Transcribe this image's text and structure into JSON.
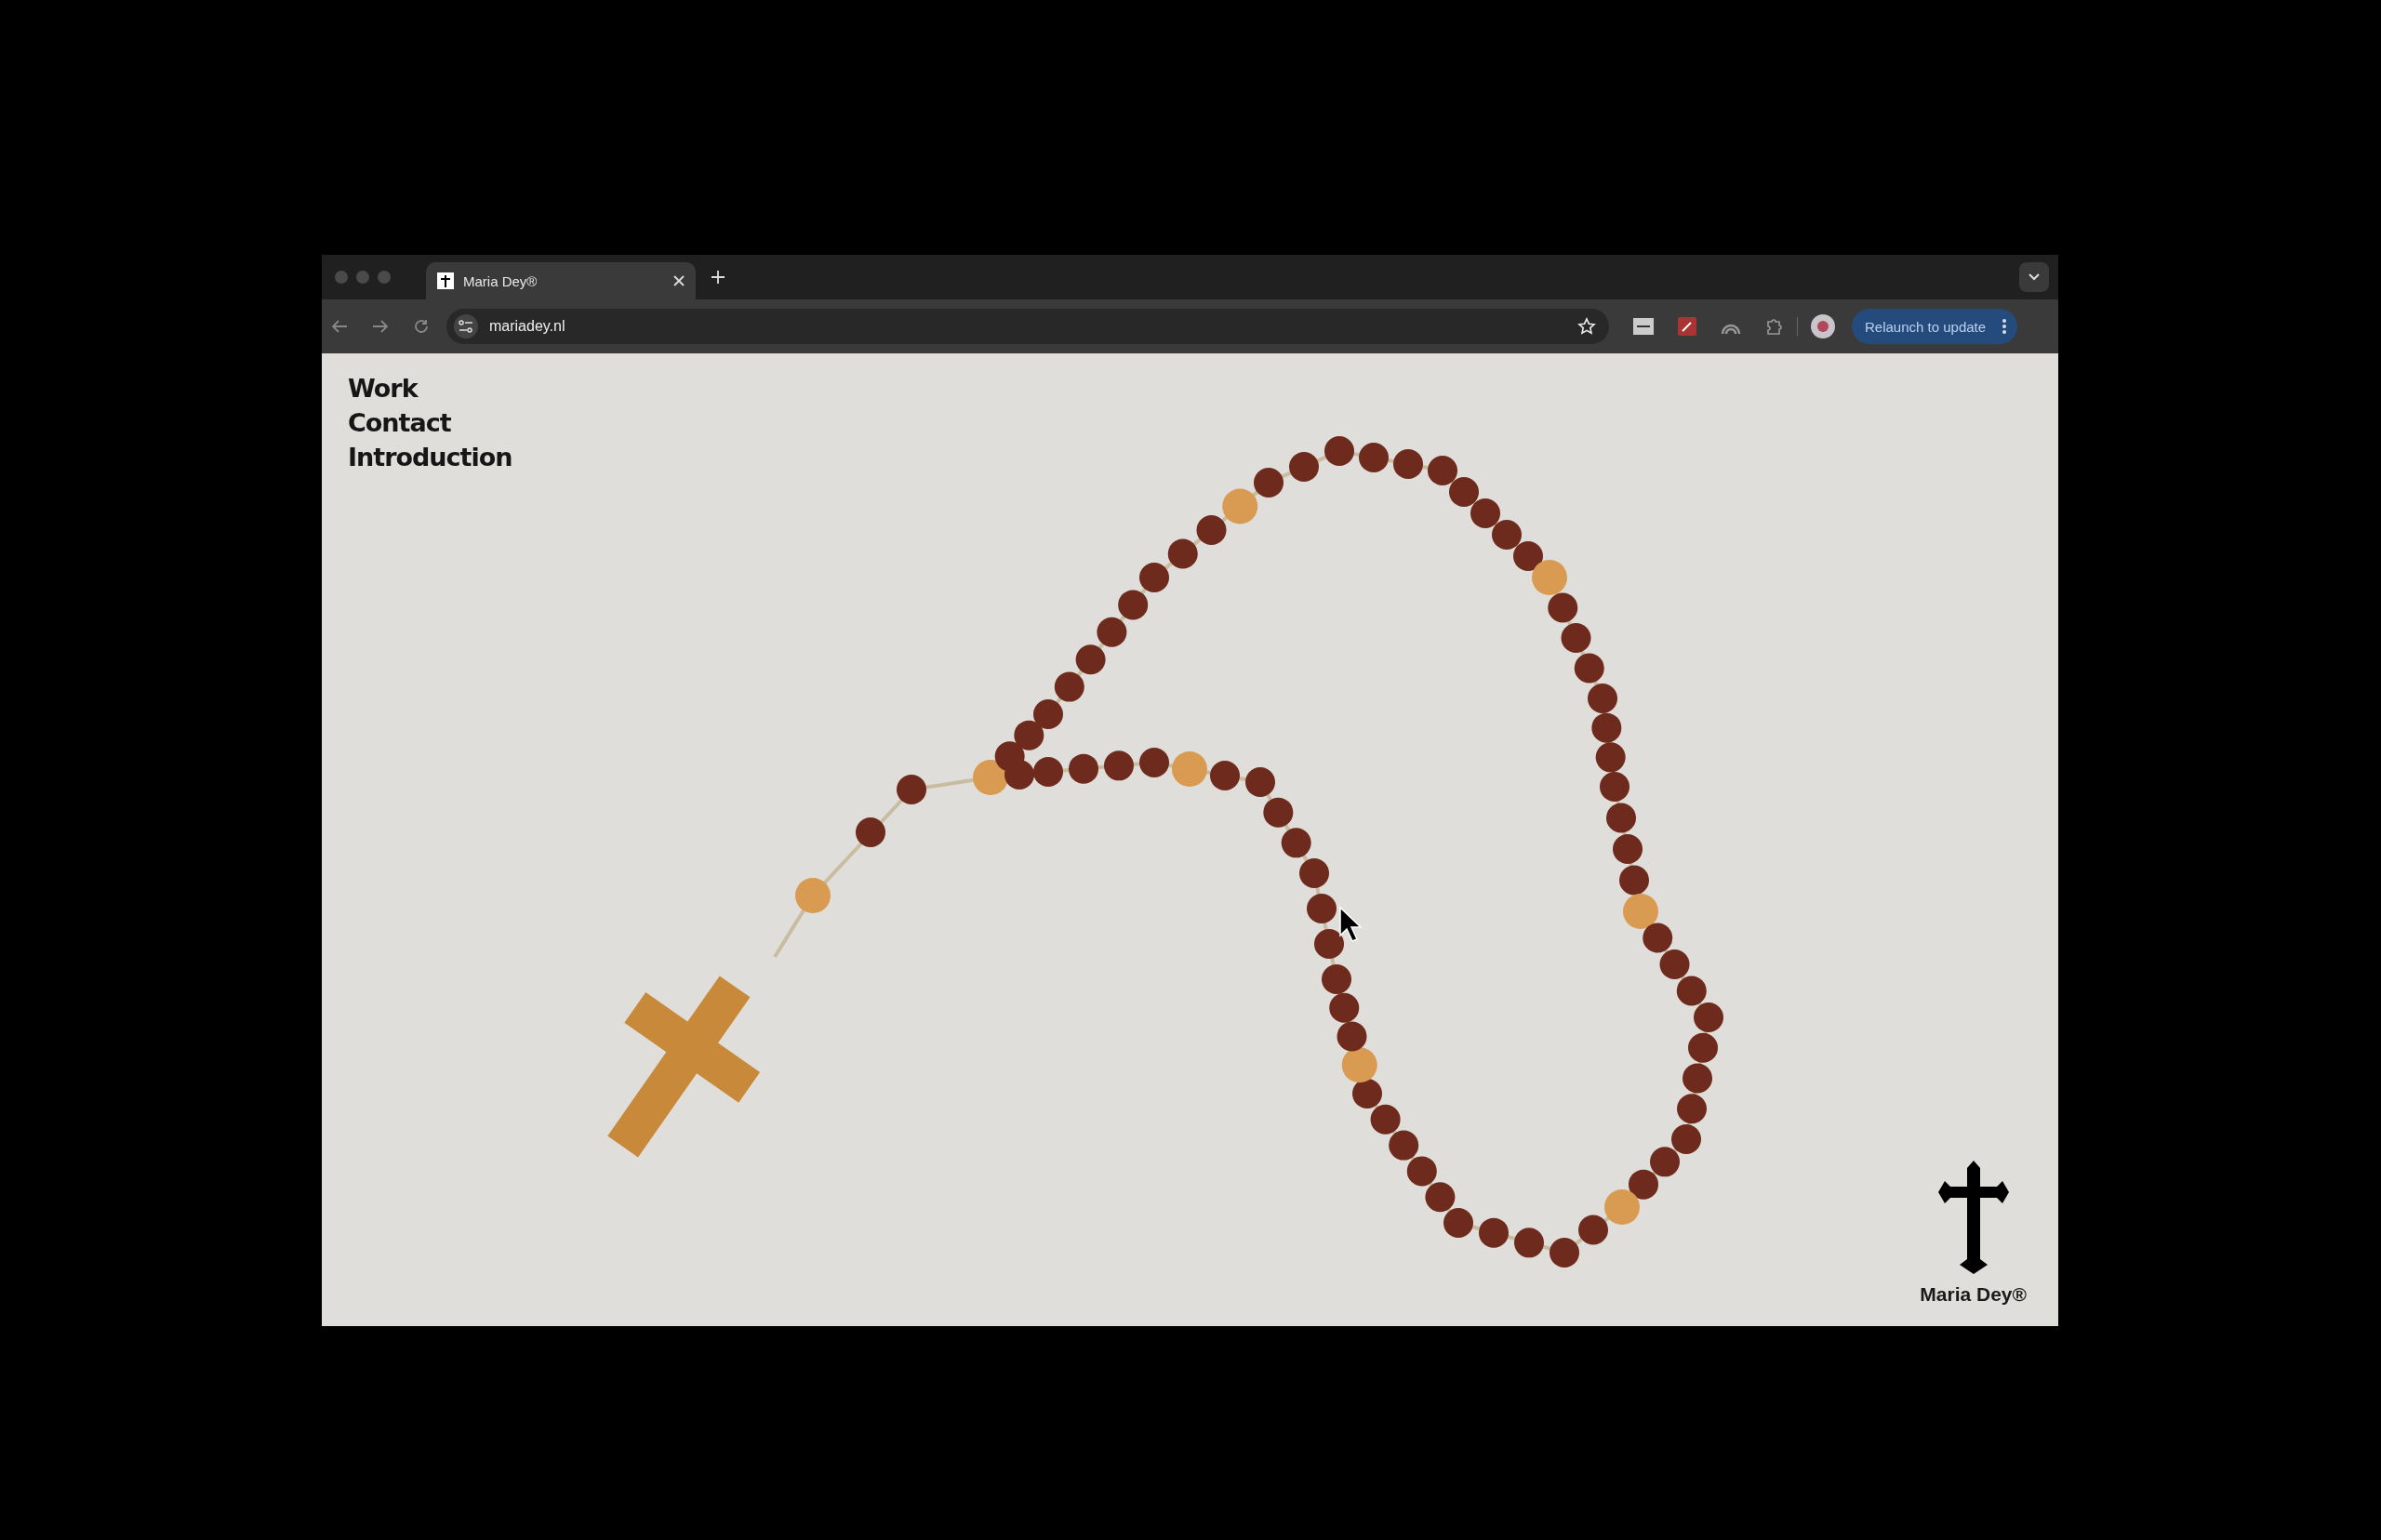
{
  "browser": {
    "tabs": [
      {
        "title": "Maria Dey®",
        "selected": true
      }
    ],
    "address": "mariadey.nl",
    "update_button": "Relaunch to update"
  },
  "site": {
    "nav": [
      {
        "label": "Work"
      },
      {
        "label": "Contact"
      },
      {
        "label": "Introduction"
      }
    ],
    "logo": {
      "text": "Maria Dey®"
    }
  }
}
